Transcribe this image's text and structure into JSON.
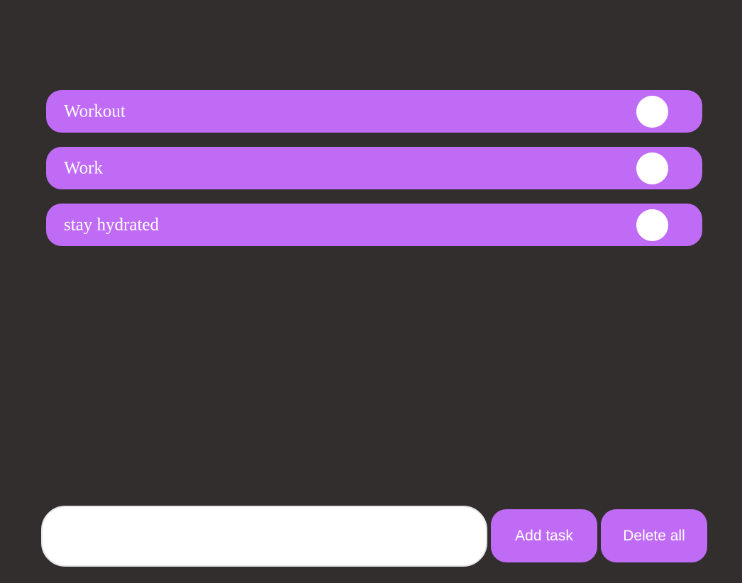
{
  "tasks": [
    {
      "label": "Workout"
    },
    {
      "label": "Work"
    },
    {
      "label": "stay hydrated"
    }
  ],
  "composer": {
    "input_value": "",
    "input_placeholder": "",
    "add_label": "Add task",
    "delete_label": "Delete all"
  },
  "colors": {
    "background": "#322e2e",
    "accent": "#c06bf5",
    "toggle": "#ffffff",
    "text": "#ffffff"
  }
}
